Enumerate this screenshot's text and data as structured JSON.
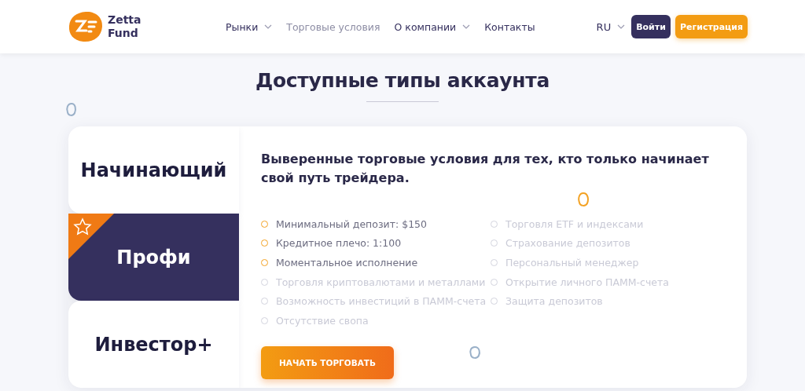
{
  "header": {
    "logo": {
      "line1": "Zetta",
      "line2": "Fund"
    },
    "nav": [
      {
        "label": "Рынки",
        "dropdown": true,
        "selected": false
      },
      {
        "label": "Торговые условия",
        "dropdown": false,
        "selected": true
      },
      {
        "label": "О компании",
        "dropdown": true,
        "selected": false
      },
      {
        "label": "Контакты",
        "dropdown": false,
        "selected": false
      }
    ],
    "language": "RU",
    "login": "Войти",
    "register": "Регистрация"
  },
  "title": "Доступные типы аккаунта",
  "account_tabs": [
    {
      "label": "Начинающий",
      "selected": false,
      "featured": false
    },
    {
      "label": "Профи",
      "selected": true,
      "featured": true
    },
    {
      "label": "Инвестор+",
      "selected": false,
      "featured": false
    }
  ],
  "panel": {
    "heading": "Выверенные торговые условия для тех, кто только начинает свой путь трейдера.",
    "features": [
      {
        "text": "Минимальный депозит: $150",
        "included": true
      },
      {
        "text": "Кредитное плечо: 1:100",
        "included": true
      },
      {
        "text": "Моментальное исполнение",
        "included": true
      },
      {
        "text": "Торговля криптовалютами и металлами",
        "included": false
      },
      {
        "text": "Возможность инвестиций в ПАММ-счета",
        "included": false
      },
      {
        "text": "Отсутствие свопа",
        "included": false
      },
      {
        "text": "Торговля ETF и индексами",
        "included": false
      },
      {
        "text": "Страхование депозитов",
        "included": false
      },
      {
        "text": "Персональный менеджер",
        "included": false
      },
      {
        "text": "Открытие личного ПАММ-счета",
        "included": false
      },
      {
        "text": "Защита депозитов",
        "included": false
      }
    ],
    "button": "НАЧАТЬ ТОРГОВАТЬ"
  }
}
